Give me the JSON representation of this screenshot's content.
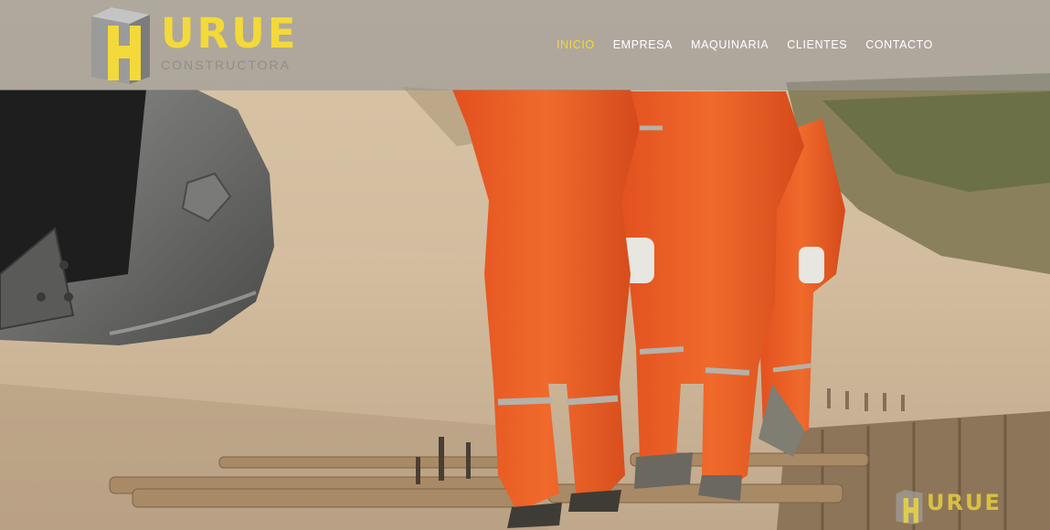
{
  "brand": {
    "name": "HURUE",
    "name_rest": "URUE",
    "tagline": "CONSTRUCTORA",
    "accent_color": "#f3d93a"
  },
  "nav": {
    "items": [
      {
        "label": "INICIO",
        "active": true
      },
      {
        "label": "EMPRESA",
        "active": false
      },
      {
        "label": "MAQUINARIA",
        "active": false
      },
      {
        "label": "CLIENTES",
        "active": false
      },
      {
        "label": "CONTACTO",
        "active": false
      }
    ]
  },
  "hero": {
    "image": "workers-in-orange-coveralls-with-excavator-bucket"
  },
  "watermark": {
    "name_rest": "URUE"
  }
}
